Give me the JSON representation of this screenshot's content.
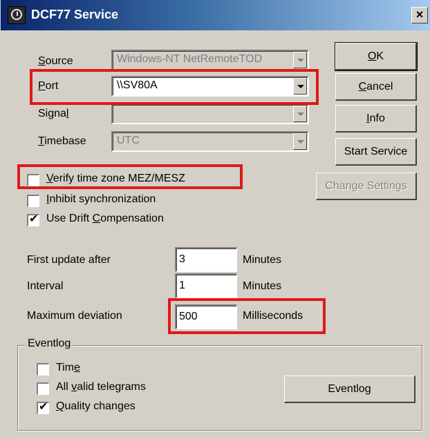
{
  "window": {
    "title": "DCF77 Service",
    "close_label": "×",
    "icon": "clock-icon"
  },
  "fields": {
    "source_label": "Source",
    "source_value": "Windows-NT NetRemoteTOD",
    "port_label": "Port",
    "port_value": "\\\\SV80A",
    "signal_label": "Signal",
    "signal_value": "",
    "timebase_label": "Timebase",
    "timebase_value": "UTC"
  },
  "buttons": {
    "ok": "OK",
    "cancel": "Cancel",
    "info": "Info",
    "start_service": "Start Service",
    "change_settings": "Change Settings",
    "eventlog": "Eventlog"
  },
  "checkboxes": [
    {
      "label": "Verify time zone MEZ/MESZ",
      "checked": false
    },
    {
      "label": "Inhibit synchronization",
      "checked": false
    },
    {
      "label": "Use Drift Compensation",
      "checked": true
    }
  ],
  "timing": {
    "first_update_label": "First update after",
    "first_update_value": "3",
    "first_update_unit": "Minutes",
    "interval_label": "Interval",
    "interval_value": "1",
    "interval_unit": "Minutes",
    "max_dev_label": "Maximum deviation",
    "max_dev_value": "500",
    "max_dev_unit": "Milliseconds"
  },
  "eventlog": {
    "group_title": "Eventlog",
    "items": [
      {
        "label": "Time",
        "checked": false
      },
      {
        "label": "All valid telegrams",
        "checked": false
      },
      {
        "label": "Quality changes",
        "checked": true
      }
    ]
  },
  "check_mark": "✔",
  "colors": {
    "dialog_bg": "#d4d0c8",
    "title_start": "#0a246a",
    "title_end": "#a6caf0",
    "highlight": "#e01818"
  }
}
